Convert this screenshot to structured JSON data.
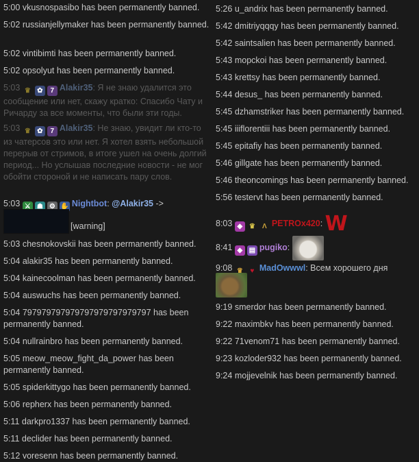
{
  "colors": {
    "background": "#1a1a1a",
    "text": "#c8c8c8",
    "dim_text": "#5a5a5a",
    "user_alakir": "#5a7bb3",
    "user_nightbot": "#6b8bd6",
    "user_petro": "#c0151b",
    "user_pugiko": "#b07fd6",
    "user_madowwwl": "#5a8fd6",
    "mention": "#8fb1e8"
  },
  "left": {
    "bans": [
      {
        "time": "5:00",
        "text": "vkusnospasibo has been permanently banned."
      },
      {
        "time": "5:02",
        "text": "russianjellymaker has been permanently banned."
      },
      {
        "time": "5:02",
        "text": "vintibimti has been permanently banned."
      },
      {
        "time": "5:02",
        "text": "opsolyut has been permanently banned."
      }
    ],
    "deleted1": {
      "time": "5:03",
      "name": "Alakir35",
      "text": ": Я не знаю удалится это сообщение или нет, скажу кратко: Спасибо Чату и Ричарду за все моменты, что были эти годы."
    },
    "deleted2": {
      "time": "5:03",
      "name": "Alakir35",
      "text": ": Не знаю, увидит ли кто-то из чатерсов это или нет. Я хотел взять небольшой перерыв от стримов, в итоге ушел на очень долгий период... Но услышав последние новости - не мог обойти стороной и не написать пару слов."
    },
    "nightbot": {
      "time": "5:03",
      "name": "Nightbot",
      "mention": "@Alakir35",
      "arrow": "->",
      "warning": "[warning]"
    },
    "bans2": [
      {
        "time": "5:03",
        "text": "chesnokovskii has been permanently banned."
      },
      {
        "time": "5:04",
        "text": "alakir35 has been permanently banned."
      },
      {
        "time": "5:04",
        "text": "kainecoolman has been permanently banned."
      },
      {
        "time": "5:04",
        "text": "auswuchs has been permanently banned."
      },
      {
        "time": "5:04",
        "text": "797979797979797979797979797 has been permanently banned."
      },
      {
        "time": "5:04",
        "text": "nullrainbro has been permanently banned."
      },
      {
        "time": "5:05",
        "text": "meow_meow_fight_da_power has been permanently banned."
      },
      {
        "time": "5:05",
        "text": "spiderkittygo has been permanently banned."
      },
      {
        "time": "5:06",
        "text": "repherx has been permanently banned."
      },
      {
        "time": "5:11",
        "text": "darkpro1337 has been permanently banned."
      },
      {
        "time": "5:11",
        "text": "declider has been permanently banned."
      },
      {
        "time": "5:12",
        "text": "voresenn has been permanently banned."
      }
    ]
  },
  "right": {
    "bans": [
      {
        "time": "5:26",
        "text": "u_andrix has been permanently banned."
      },
      {
        "time": "5:42",
        "text": "dmitriyqqqy has been permanently banned."
      },
      {
        "time": "5:42",
        "text": "saintsalien has been permanently banned."
      },
      {
        "time": "5:43",
        "text": "mopckoi has been permanently banned."
      },
      {
        "time": "5:43",
        "text": "krettsy has been permanently banned."
      },
      {
        "time": "5:44",
        "text": "desus_ has been permanently banned."
      },
      {
        "time": "5:45",
        "text": "dzhamstriker has been permanently banned."
      },
      {
        "time": "5:45",
        "text": "iiiflorentiii has been permanently banned."
      },
      {
        "time": "5:45",
        "text": "epitafiy has been permanently banned."
      },
      {
        "time": "5:46",
        "text": "gillgate has been permanently banned."
      },
      {
        "time": "5:46",
        "text": "theoncomings has been permanently banned."
      },
      {
        "time": "5:56",
        "text": "testervt has been permanently banned."
      }
    ],
    "petro": {
      "time": "8:03",
      "name": "PETROx420",
      "colon": ":",
      "emote_text": "W"
    },
    "pugiko": {
      "time": "8:41",
      "name": "pugiko",
      "colon": ":"
    },
    "mad": {
      "time": "9:08",
      "name": "MadOwwwl",
      "text": ": Всем хорошего дня"
    },
    "bans2": [
      {
        "time": "9:19",
        "text": "smerdor has been permanently banned."
      },
      {
        "time": "9:22",
        "text": "maximbkv has been permanently banned."
      },
      {
        "time": "9:22",
        "text": "71venom71 has been permanently banned."
      },
      {
        "time": "9:23",
        "text": "kozloder932 has been permanently banned."
      },
      {
        "time": "9:24",
        "text": "mojjevelnik has been permanently banned."
      }
    ]
  }
}
